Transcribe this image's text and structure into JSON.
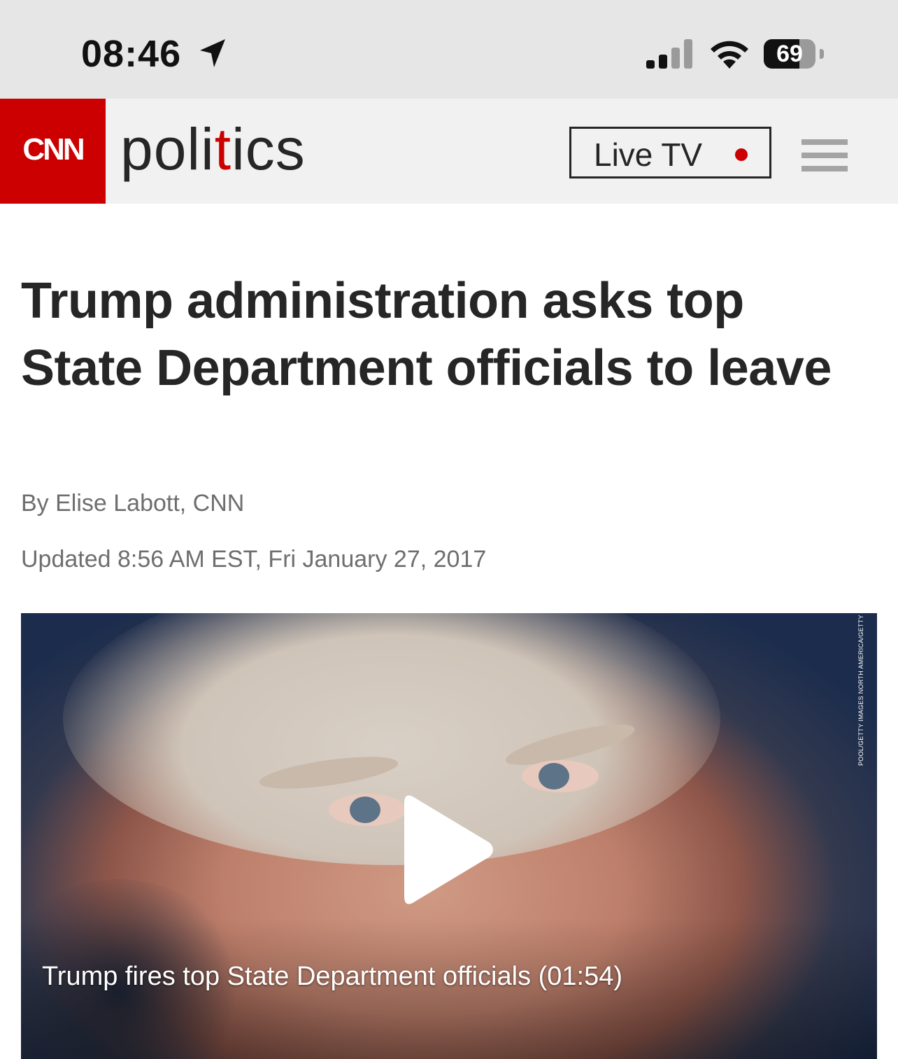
{
  "status_bar": {
    "time": "08:46",
    "battery": "69",
    "battery_level": 0.69
  },
  "header": {
    "logo_text": "CNN",
    "section_parts": [
      "pol",
      "i",
      "t",
      "i",
      "cs"
    ],
    "live_tv_label": "Live TV",
    "accent_color": "#cc0000"
  },
  "article": {
    "headline": "Trump administration asks top State Department officials to leave",
    "byline": "By Elise Labott, CNN",
    "updated": "Updated 8:56 AM EST, Fri January 27, 2017"
  },
  "video": {
    "caption": "Trump fires top State Department officials (01:54)",
    "photo_credit": "POOL/GETTY IMAGES NORTH AMERICA/GETTY IMAGES"
  },
  "icons": {
    "location": "location-arrow-icon",
    "signal": "cellular-signal-icon",
    "wifi": "wifi-icon",
    "battery": "battery-icon",
    "live": "live-dot-icon",
    "menu": "hamburger-menu-icon",
    "play": "play-icon"
  }
}
